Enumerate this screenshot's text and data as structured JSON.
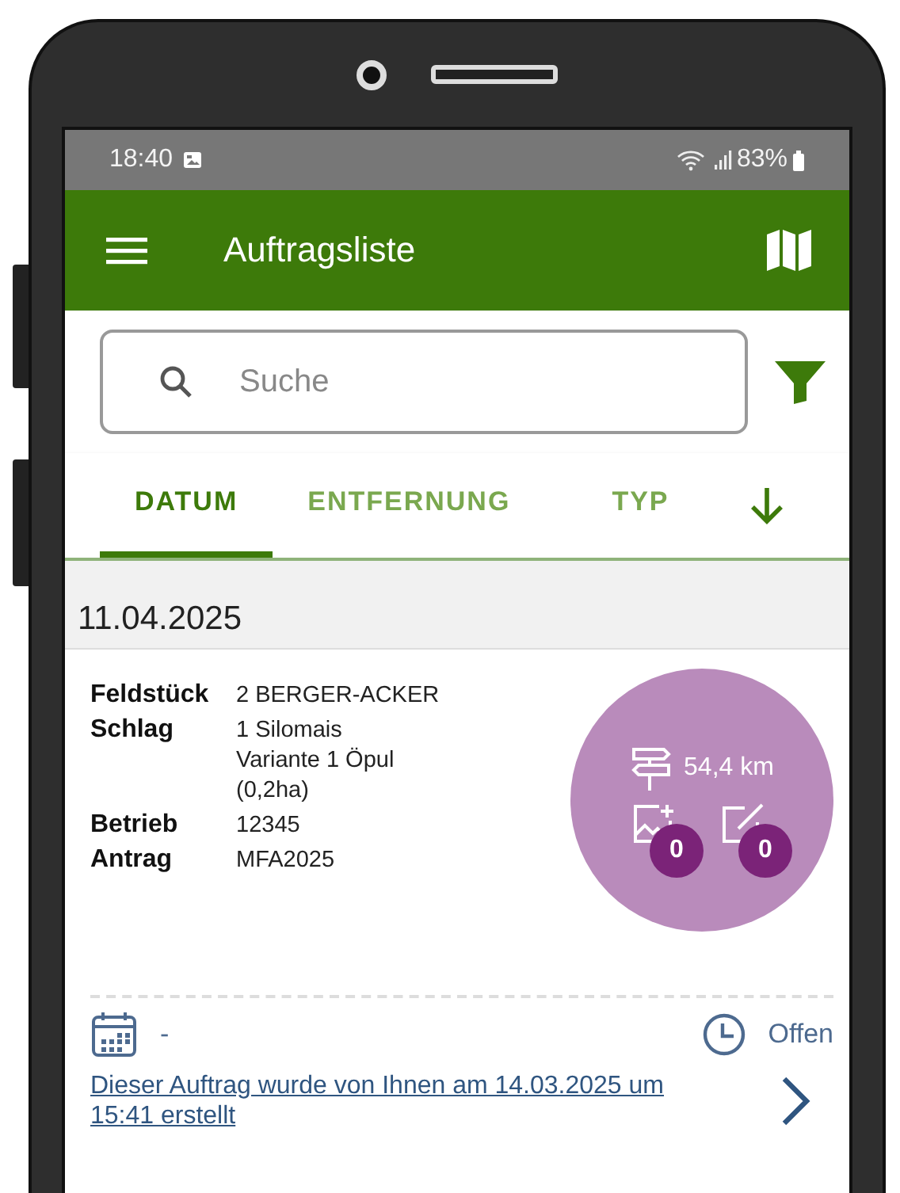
{
  "status_bar": {
    "time": "18:40",
    "battery": "83%"
  },
  "app_bar": {
    "title": "Auftragsliste"
  },
  "search": {
    "placeholder": "Suche"
  },
  "sort_tabs": [
    {
      "label": "DATUM",
      "selected": true
    },
    {
      "label": "ENTFERNUNG",
      "selected": false
    },
    {
      "label": "TYP",
      "selected": false
    }
  ],
  "date_header": "11.04.2025",
  "order": {
    "fields": [
      {
        "label": "Feldstück",
        "lines": [
          "2  BERGER-ACKER"
        ]
      },
      {
        "label": "Schlag",
        "lines": [
          "1  Silomais",
          "Variante 1 Öpul",
          "(0,2ha)"
        ]
      },
      {
        "label": "Betrieb",
        "lines": [
          "12345"
        ]
      },
      {
        "label": "Antrag",
        "lines": [
          "MFA2025"
        ]
      }
    ],
    "distance": "54,4 km",
    "photo_count": "0",
    "note_count": "0",
    "schedule": "-",
    "status": "Offen",
    "created_note": "Dieser Auftrag wurde von Ihnen am 14.03.2025 um 15:41 erstellt"
  }
}
